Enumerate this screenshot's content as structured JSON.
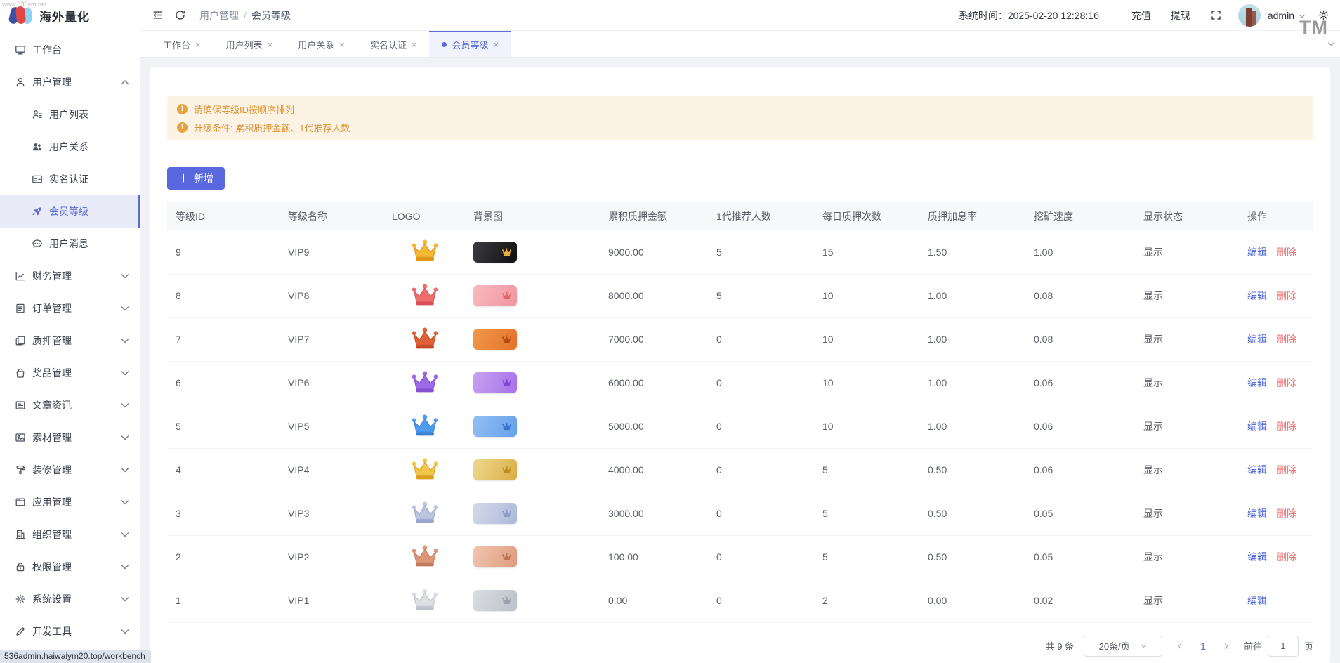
{
  "watermarks": {
    "top_left": "www.638ym.net",
    "tm": "TM",
    "status_url": "536admin.haiwaiym20.top/workbench"
  },
  "brand": {
    "name": "海外量化"
  },
  "header": {
    "breadcrumb": {
      "parent": "用户管理",
      "separator": "/",
      "current": "会员等级"
    },
    "system_time_label": "系统时间：",
    "system_time": "2025-02-20 12:28:16",
    "recharge_label": "充值",
    "withdraw_label": "提现",
    "username": "admin"
  },
  "tabs": [
    {
      "name": "workbench",
      "label": "工作台",
      "active": false
    },
    {
      "name": "user-list",
      "label": "用户列表",
      "active": false
    },
    {
      "name": "user-relations",
      "label": "用户关系",
      "active": false
    },
    {
      "name": "real-name-auth",
      "label": "实名认证",
      "active": false
    },
    {
      "name": "member-level",
      "label": "会员等级",
      "active": true
    }
  ],
  "tab_close_glyph": "×",
  "sidebar": {
    "items": [
      {
        "name": "workbench",
        "label": "工作台",
        "icon": "monitor"
      },
      {
        "name": "user-management",
        "label": "用户管理",
        "icon": "user",
        "expanded": true,
        "children": [
          {
            "name": "user-list",
            "label": "用户列表",
            "icon": "user-list",
            "active": false
          },
          {
            "name": "user-relations",
            "label": "用户关系",
            "icon": "users",
            "active": false
          },
          {
            "name": "real-name-auth",
            "label": "实名认证",
            "icon": "id-card",
            "active": false
          },
          {
            "name": "member-level",
            "label": "会员等级",
            "icon": "rocket",
            "active": true
          },
          {
            "name": "user-messages",
            "label": "用户消息",
            "icon": "chat",
            "active": false
          }
        ]
      },
      {
        "name": "finance",
        "label": "财务管理",
        "icon": "chart",
        "collapsible": true
      },
      {
        "name": "orders",
        "label": "订单管理",
        "icon": "order",
        "collapsible": true
      },
      {
        "name": "pledge",
        "label": "质押管理",
        "icon": "pledge",
        "collapsible": true
      },
      {
        "name": "prizes",
        "label": "奖品管理",
        "icon": "bag",
        "collapsible": true
      },
      {
        "name": "articles",
        "label": "文章资讯",
        "icon": "article",
        "collapsible": true
      },
      {
        "name": "materials",
        "label": "素材管理",
        "icon": "image",
        "collapsible": true
      },
      {
        "name": "decoration",
        "label": "装修管理",
        "icon": "paint",
        "collapsible": true
      },
      {
        "name": "apps",
        "label": "应用管理",
        "icon": "app",
        "collapsible": true
      },
      {
        "name": "organization",
        "label": "组织管理",
        "icon": "org",
        "collapsible": true
      },
      {
        "name": "permissions",
        "label": "权限管理",
        "icon": "lock",
        "collapsible": true
      },
      {
        "name": "settings",
        "label": "系统设置",
        "icon": "gear",
        "collapsible": true
      },
      {
        "name": "dev-tools",
        "label": "开发工具",
        "icon": "pen",
        "collapsible": true
      }
    ]
  },
  "alerts": [
    "请确保等级ID按顺序排列",
    "升级条件: 累积质押金额、1代推荐人数"
  ],
  "add_button_label": "新增",
  "colors": {
    "accent": "#5a6ad6",
    "warning": "#e6a23c",
    "edit_link": "#4a63d8",
    "delete_link": "#ef7070"
  },
  "table": {
    "columns": [
      "等级ID",
      "等级名称",
      "LOGO",
      "背景图",
      "累积质押金额",
      "1代推荐人数",
      "每日质押次数",
      "质押加息率",
      "挖矿速度",
      "显示状态",
      "操作"
    ],
    "rows": [
      {
        "id": "9",
        "name": "VIP9",
        "crown": [
          "#f5b832",
          "#df9415"
        ],
        "chip": [
          "#3c3c40",
          "#0f0f12"
        ],
        "mini": "#f0b13c",
        "amount": "9000.00",
        "referrals": "5",
        "daily_pledges": "15",
        "interest_rate": "1.50",
        "mining_speed": "1.00",
        "status": "显示",
        "actions": [
          "编辑",
          "删除"
        ]
      },
      {
        "id": "8",
        "name": "VIP8",
        "crown": [
          "#ee6d6d",
          "#d84f55"
        ],
        "chip": [
          "#f8b9c0",
          "#f2959f"
        ],
        "mini": "#df6570",
        "amount": "8000.00",
        "referrals": "5",
        "daily_pledges": "10",
        "interest_rate": "1.00",
        "mining_speed": "0.08",
        "status": "显示",
        "actions": [
          "编辑",
          "删除"
        ]
      },
      {
        "id": "7",
        "name": "VIP7",
        "crown": [
          "#e06038",
          "#c44a20"
        ],
        "chip": [
          "#f2974a",
          "#e3732a"
        ],
        "mini": "#b54a10",
        "amount": "7000.00",
        "referrals": "0",
        "daily_pledges": "10",
        "interest_rate": "1.00",
        "mining_speed": "0.08",
        "status": "显示",
        "actions": [
          "编辑",
          "删除"
        ]
      },
      {
        "id": "6",
        "name": "VIP6",
        "crown": [
          "#9d69e8",
          "#8450d0"
        ],
        "chip": [
          "#c7a2f2",
          "#a671e8"
        ],
        "mini": "#7e42d6",
        "amount": "6000.00",
        "referrals": "0",
        "daily_pledges": "10",
        "interest_rate": "1.00",
        "mining_speed": "0.06",
        "status": "显示",
        "actions": [
          "编辑",
          "删除"
        ]
      },
      {
        "id": "5",
        "name": "VIP5",
        "crown": [
          "#4f9bed",
          "#3a80d6"
        ],
        "chip": [
          "#93bff4",
          "#66a0ea"
        ],
        "mini": "#3576cc",
        "amount": "5000.00",
        "referrals": "0",
        "daily_pledges": "10",
        "interest_rate": "1.00",
        "mining_speed": "0.06",
        "status": "显示",
        "actions": [
          "编辑",
          "删除"
        ]
      },
      {
        "id": "4",
        "name": "VIP4",
        "crown": [
          "#f3c64a",
          "#dda020"
        ],
        "chip": [
          "#f0d88e",
          "#d9ad45"
        ],
        "mini": "#be8b20",
        "amount": "4000.00",
        "referrals": "0",
        "daily_pledges": "5",
        "interest_rate": "0.50",
        "mining_speed": "0.06",
        "status": "显示",
        "actions": [
          "编辑",
          "删除"
        ]
      },
      {
        "id": "3",
        "name": "VIP3",
        "crown": [
          "#bcc5e0",
          "#9aa6cc"
        ],
        "chip": [
          "#d3d9ec",
          "#aeb9d8"
        ],
        "mini": "#8e9cc4",
        "amount": "3000.00",
        "referrals": "0",
        "daily_pledges": "5",
        "interest_rate": "0.50",
        "mining_speed": "0.05",
        "status": "显示",
        "actions": [
          "编辑",
          "删除"
        ]
      },
      {
        "id": "2",
        "name": "VIP2",
        "crown": [
          "#de9678",
          "#c47a5a"
        ],
        "chip": [
          "#f2c5b0",
          "#de9b7e"
        ],
        "mini": "#bd7150",
        "amount": "100.00",
        "referrals": "0",
        "daily_pledges": "5",
        "interest_rate": "0.50",
        "mining_speed": "0.05",
        "status": "显示",
        "actions": [
          "编辑",
          "删除"
        ]
      },
      {
        "id": "1",
        "name": "VIP1",
        "crown": [
          "#dcdee2",
          "#c0c3ca"
        ],
        "chip": [
          "#dadde2",
          "#bcc1c9"
        ],
        "mini": "#9aa0ac",
        "amount": "0.00",
        "referrals": "0",
        "daily_pledges": "2",
        "interest_rate": "0.00",
        "mining_speed": "0.02",
        "status": "显示",
        "actions": [
          "编辑"
        ]
      }
    ]
  },
  "pagination": {
    "total": "共 9 条",
    "page_size": "20条/页",
    "current_page": "1",
    "goto_label": "前往",
    "goto_value": "1",
    "page_suffix": "页"
  }
}
